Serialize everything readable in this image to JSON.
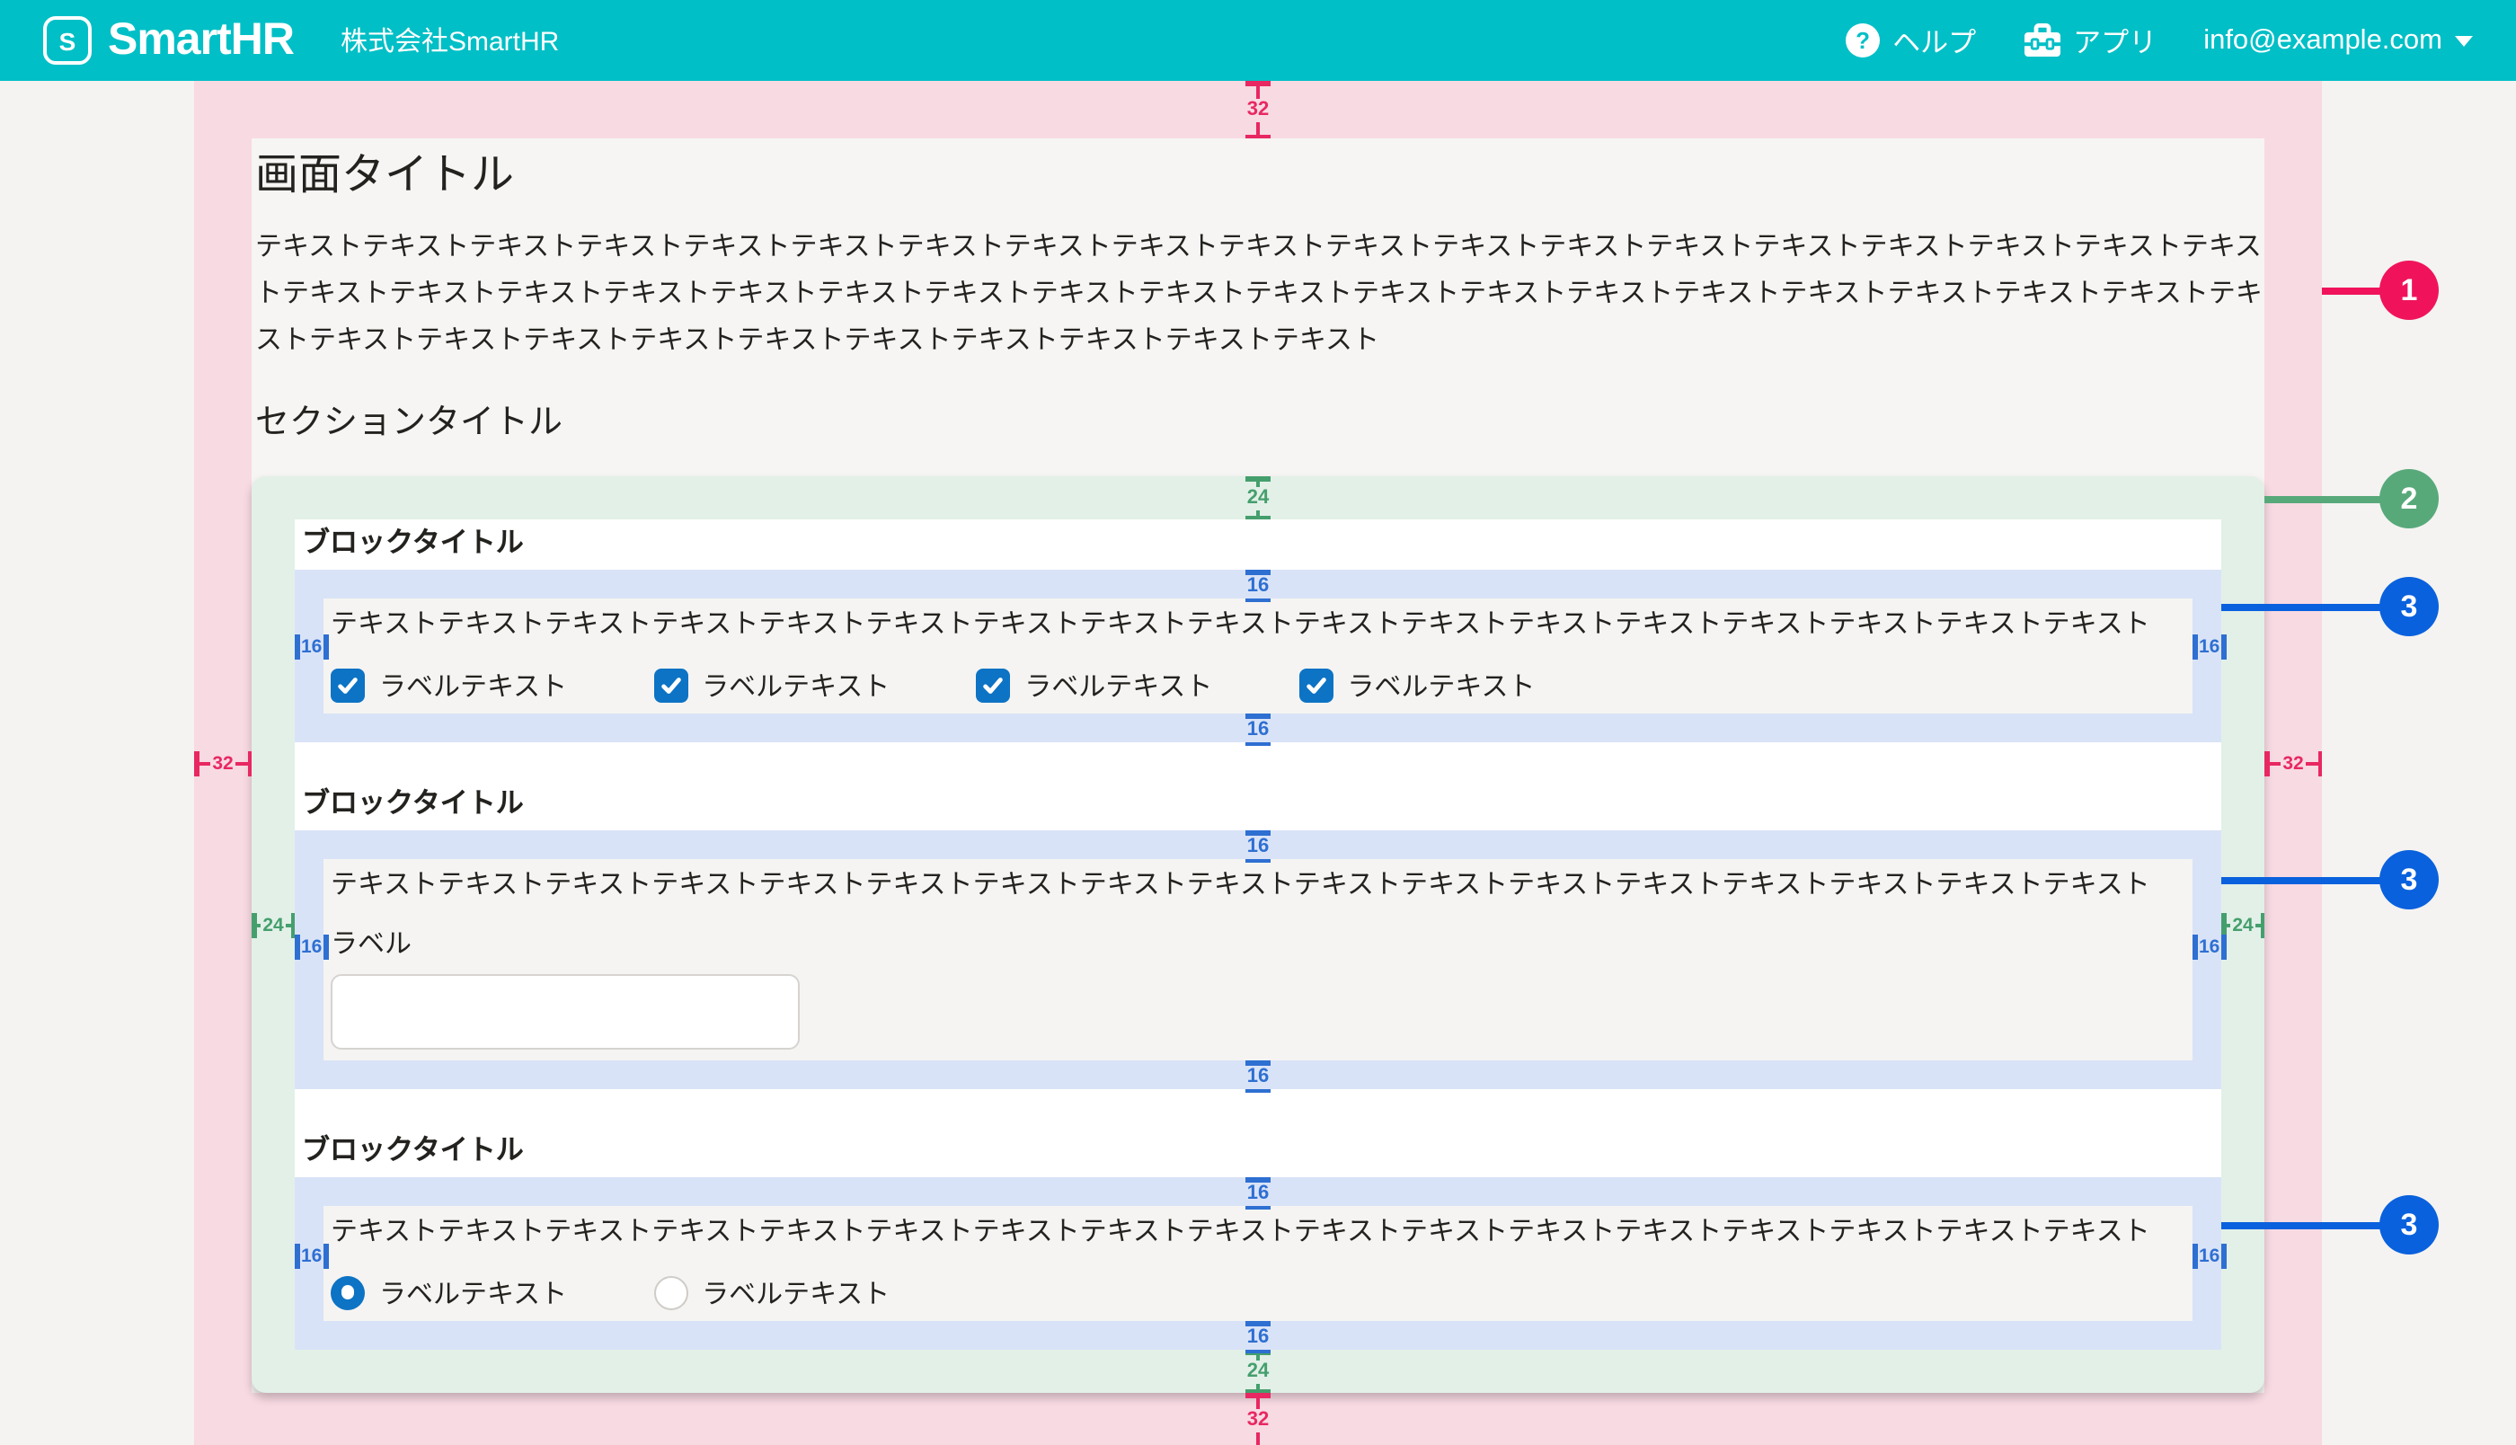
{
  "colors": {
    "brand_teal": "#00bfc6",
    "page_bg": "#f4f3f1",
    "card_bg": "#f6f5f3",
    "content_bg": "#f5f4f2",
    "margin_pink": "#f8dae3",
    "section_green": "#e2f0e8",
    "block_blue": "#d9e3f7",
    "marker_pink": "#e82862",
    "marker_green": "#459f6d",
    "marker_blue": "#2e6fd2",
    "badge_pink": "#f0135c",
    "badge_green": "#58a97a",
    "badge_blue": "#0a61dd",
    "control_blue": "#0d73c4",
    "text_main": "#23221f",
    "border_input": "#d6d3d0"
  },
  "header": {
    "logo_mark": "S",
    "product_name": "SmartHR",
    "company_name": "株式会社SmartHR",
    "help_icon_glyph": "?",
    "help_label": "ヘルプ",
    "apps_label": "アプリ",
    "account_email": "info@example.com"
  },
  "page": {
    "title": "画面タイトル",
    "lead_text": "テキストテキストテキストテキストテキストテキストテキストテキストテキストテキストテキストテキストテキストテキストテキストテキストテキストテキストテキストテキストテキストテキストテキストテキストテキストテキストテキストテキストテキストテキストテキストテキストテキストテキストテキストテキストテキストテキストテキストテキストテキストテキストテキストテキストテキストテキストテキストテキスト",
    "section_title": "セクションタイトル"
  },
  "blocks": [
    {
      "title": "ブロックタイトル",
      "text": "テキストテキストテキストテキストテキストテキストテキストテキストテキストテキストテキストテキストテキストテキストテキストテキストテキスト",
      "type": "checkbox-group",
      "options": [
        "ラベルテキスト",
        "ラベルテキスト",
        "ラベルテキスト",
        "ラベルテキスト"
      ],
      "checked": [
        true,
        true,
        true,
        true
      ]
    },
    {
      "title": "ブロックタイトル",
      "text": "テキストテキストテキストテキストテキストテキストテキストテキストテキストテキストテキストテキストテキストテキストテキストテキストテキスト",
      "type": "text-field",
      "field_label": "ラベル",
      "field_value": ""
    },
    {
      "title": "ブロックタイトル",
      "text": "テキストテキストテキストテキストテキストテキストテキストテキストテキストテキストテキストテキストテキストテキストテキストテキストテキスト",
      "type": "radio-group",
      "options": [
        "ラベルテキスト",
        "ラベルテキスト"
      ],
      "selected_index": 0
    }
  ],
  "annotations": {
    "spacing": {
      "page_margin": "32",
      "section_padding": "24",
      "block_padding": "16"
    },
    "badges": [
      "1",
      "2",
      "3",
      "3",
      "3"
    ]
  }
}
